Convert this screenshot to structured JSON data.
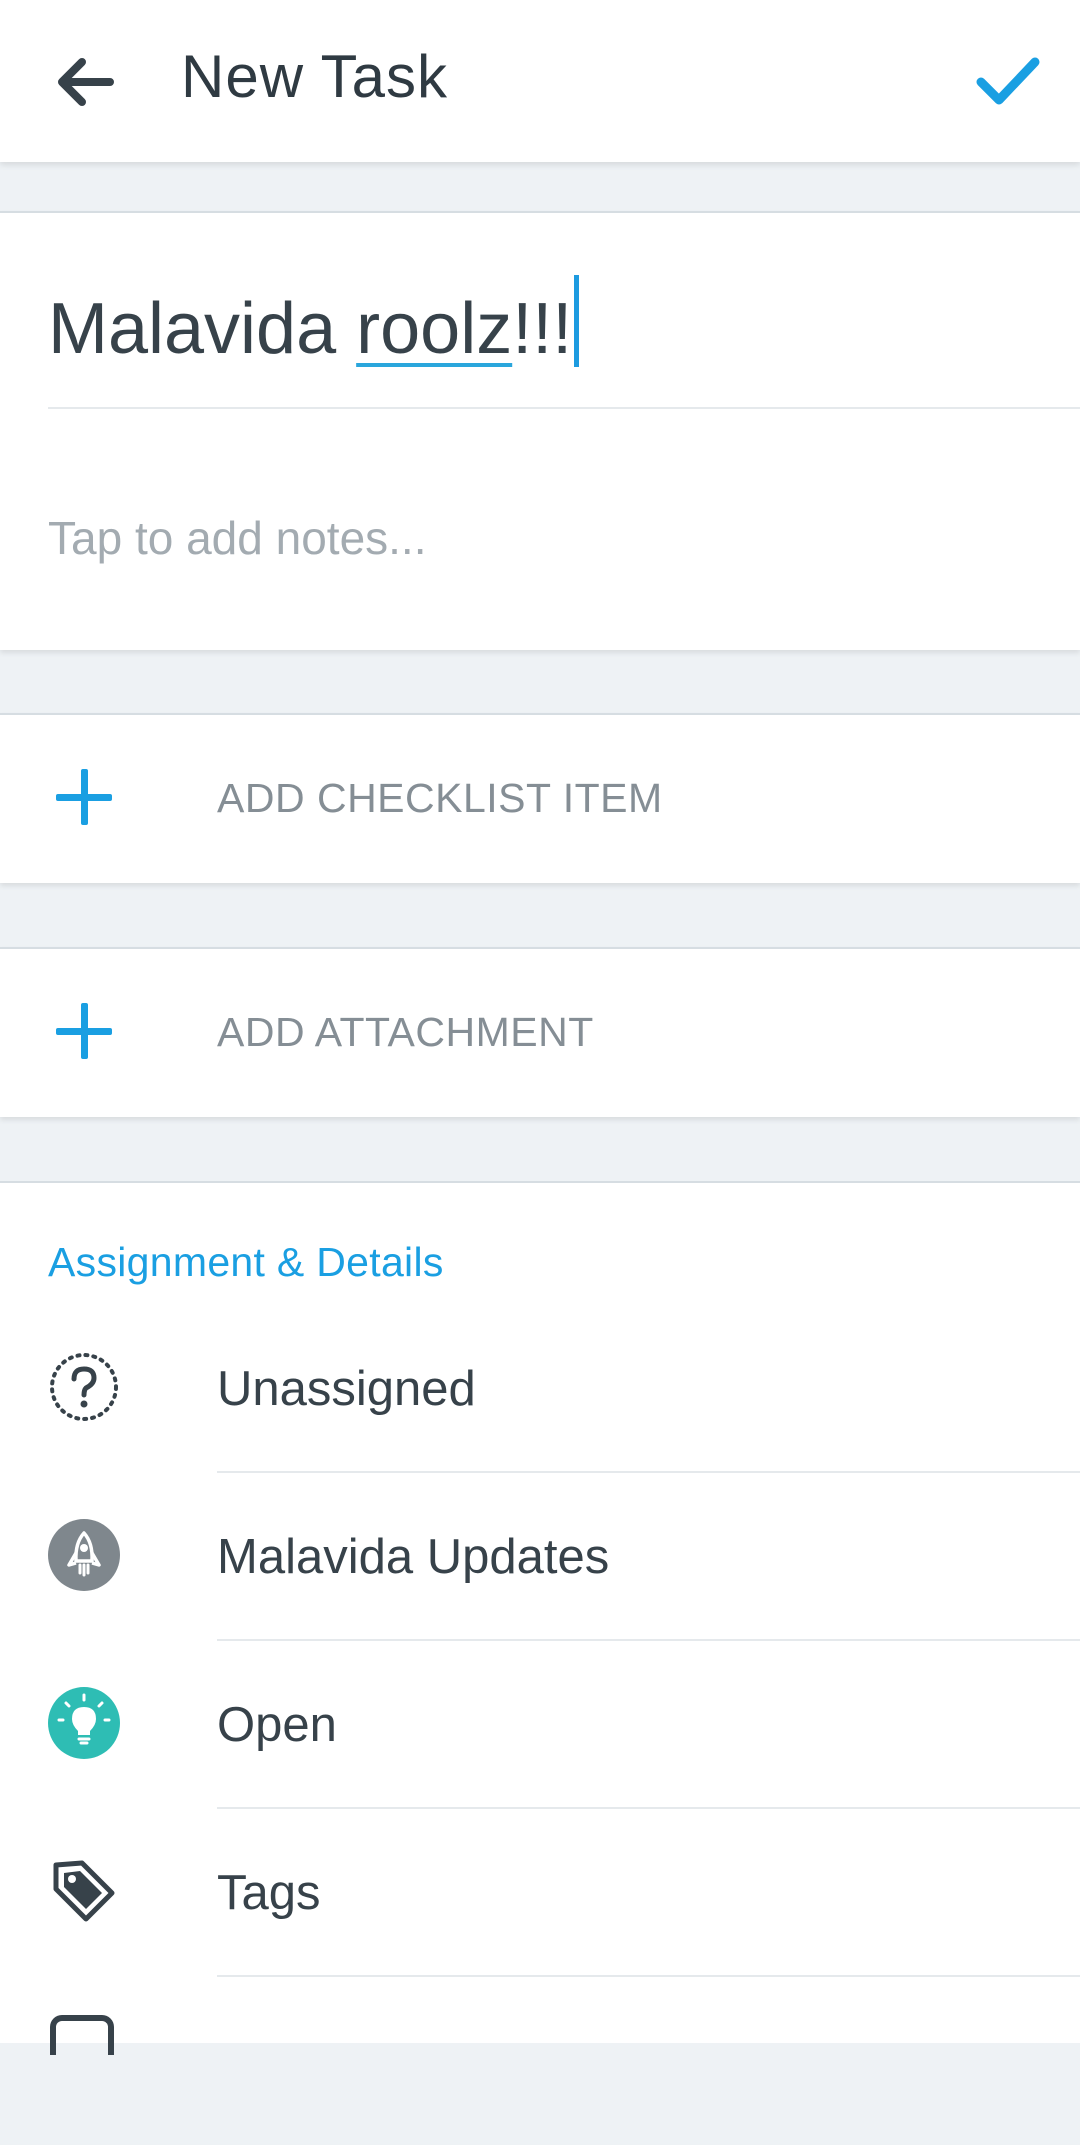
{
  "header": {
    "title": "New Task",
    "back_icon": "arrow-left-icon",
    "confirm_icon": "checkmark-icon",
    "accent_color": "#1a9fe2"
  },
  "task": {
    "title_prefix": "Malavida ",
    "title_misspelled": "roolz",
    "title_suffix": "!!!",
    "notes_placeholder": "Tap to add notes..."
  },
  "actions": {
    "checklist_label": "ADD CHECKLIST ITEM",
    "attachment_label": "ADD ATTACHMENT",
    "icon": "plus-icon"
  },
  "details": {
    "heading": "Assignment & Details",
    "rows": [
      {
        "label": "Unassigned",
        "icon": "unassigned-user-icon"
      },
      {
        "label": "Malavida Updates",
        "icon": "rocket-project-icon"
      },
      {
        "label": "Open",
        "icon": "lightbulb-status-icon",
        "color": "#2ebdb4"
      },
      {
        "label": "Tags",
        "icon": "tag-icon"
      }
    ]
  }
}
